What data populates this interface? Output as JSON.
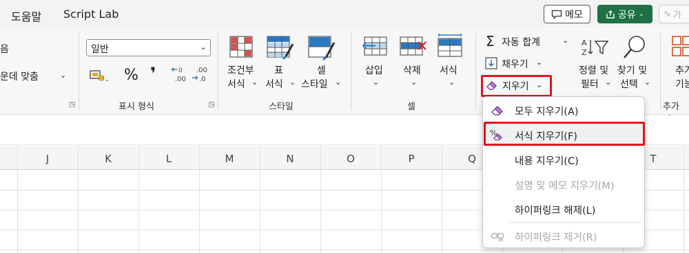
{
  "tabbar": {
    "tabs": [
      "도움말",
      "Script Lab"
    ],
    "memo_label": "메모",
    "share_label": "공유",
    "activity_label": "가"
  },
  "ribbon": {
    "alignment": {
      "partial_top": "음",
      "merge_center": "운데 맞춤"
    },
    "number": {
      "format_value": "일반",
      "percent_symbol": "%",
      "comma_symbol": "❜",
      "inc_decimal": ".00",
      "dec_decimal": ".00",
      "group_label": "표시 형식"
    },
    "styles": {
      "conditional": [
        "조건부",
        "서식"
      ],
      "table": [
        "표",
        "서식"
      ],
      "cell": [
        "셀",
        "스타일"
      ],
      "group_label": "스타일"
    },
    "cells": {
      "insert": "삽입",
      "delete": "삭제",
      "format": "서식",
      "group_label": "셀"
    },
    "editing": {
      "autosum": "자동 합계",
      "fill": "채우기",
      "clear": "지우기",
      "sort_filter": [
        "정렬 및",
        "필터"
      ],
      "find_select": [
        "찾기 및",
        "선택"
      ]
    },
    "addins": {
      "label": [
        "추가",
        "기능"
      ],
      "group_label": "추가 기"
    }
  },
  "grid": {
    "columns": [
      "J",
      "K",
      "L",
      "M",
      "N",
      "O",
      "P",
      "Q",
      "T"
    ]
  },
  "clear_menu": {
    "items": [
      {
        "label": "모두 지우기(A)",
        "icon": "eraser-icon",
        "enabled": true
      },
      {
        "label": "서식 지우기(F)",
        "icon": "clear-format-icon",
        "enabled": true
      },
      {
        "label": "내용 지우기(C)",
        "icon": "",
        "enabled": true
      },
      {
        "label": "설명 및 메모 지우기(M)",
        "icon": "",
        "enabled": false
      },
      {
        "label": "하이퍼링크 해제(L)",
        "icon": "",
        "enabled": true
      },
      {
        "label": "하이퍼링크 제거(R)",
        "icon": "unlink-icon",
        "enabled": false
      }
    ]
  },
  "colors": {
    "highlight_border": "#e0141e",
    "share_green": "#1e7145",
    "accent_blue": "#2b79c2"
  }
}
